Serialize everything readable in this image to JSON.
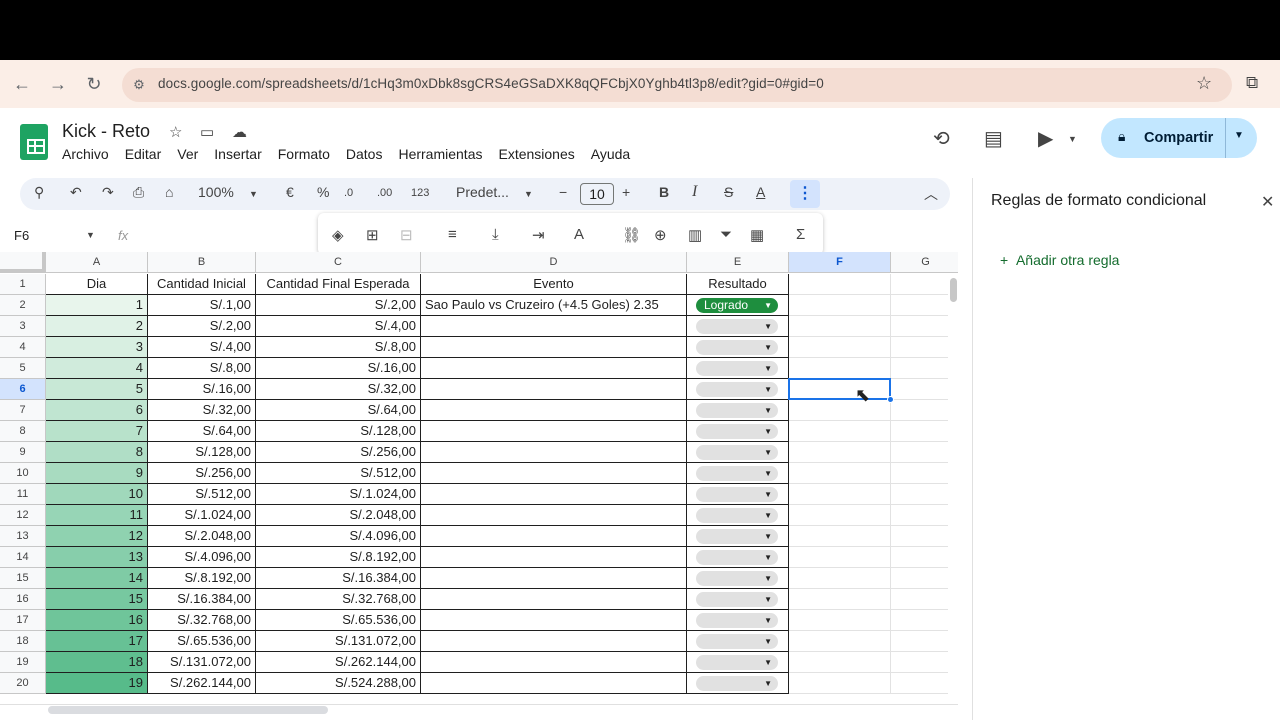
{
  "browser": {
    "url": "docs.google.com/spreadsheets/d/1cHq3m0xDbk8sgCRS4eGSaDXK8qQFCbjX0Yghb4tl3p8/edit?gid=0#gid=0"
  },
  "doc": {
    "title": "Kick - Reto",
    "menu": [
      "Archivo",
      "Editar",
      "Ver",
      "Insertar",
      "Formato",
      "Datos",
      "Herramientas",
      "Extensiones",
      "Ayuda"
    ],
    "share_label": "Compartir"
  },
  "toolbar": {
    "zoom": "100%",
    "currency": "€",
    "percent": "%",
    "dec_less": ".0",
    "dec_more": ".00",
    "number_format": "123",
    "font": "Predet...",
    "font_size": "10",
    "bold": "B",
    "italic": "I",
    "strike": "S",
    "text_color": "A"
  },
  "formula_bar": {
    "cell_ref": "F6",
    "fx": "fx"
  },
  "panel": {
    "title": "Reglas de formato condicional",
    "add_rule": "Añadir otra regla"
  },
  "colors": {
    "accent": "#1a73e8",
    "chip_logrado": "#1e8e3e",
    "share_bg": "#c2e7ff"
  },
  "sheet": {
    "columns": [
      "A",
      "B",
      "C",
      "D",
      "E",
      "F",
      "G"
    ],
    "selected_column": "F",
    "selected_row": "6",
    "headers": [
      "Dia",
      "Cantidad Inicial",
      "Cantidad Final Esperada",
      "Evento",
      "Resultado"
    ],
    "rows": [
      {
        "n": "2",
        "dia": "1",
        "ini": "S/.1,00",
        "fin": "S/.2,00",
        "evento": "Sao Paulo vs Cruzeiro (+4.5 Goles) 2.35",
        "res": "Logrado"
      },
      {
        "n": "3",
        "dia": "2",
        "ini": "S/.2,00",
        "fin": "S/.4,00",
        "evento": "",
        "res": ""
      },
      {
        "n": "4",
        "dia": "3",
        "ini": "S/.4,00",
        "fin": "S/.8,00",
        "evento": "",
        "res": ""
      },
      {
        "n": "5",
        "dia": "4",
        "ini": "S/.8,00",
        "fin": "S/.16,00",
        "evento": "",
        "res": ""
      },
      {
        "n": "6",
        "dia": "5",
        "ini": "S/.16,00",
        "fin": "S/.32,00",
        "evento": "",
        "res": ""
      },
      {
        "n": "7",
        "dia": "6",
        "ini": "S/.32,00",
        "fin": "S/.64,00",
        "evento": "",
        "res": ""
      },
      {
        "n": "8",
        "dia": "7",
        "ini": "S/.64,00",
        "fin": "S/.128,00",
        "evento": "",
        "res": ""
      },
      {
        "n": "9",
        "dia": "8",
        "ini": "S/.128,00",
        "fin": "S/.256,00",
        "evento": "",
        "res": ""
      },
      {
        "n": "10",
        "dia": "9",
        "ini": "S/.256,00",
        "fin": "S/.512,00",
        "evento": "",
        "res": ""
      },
      {
        "n": "11",
        "dia": "10",
        "ini": "S/.512,00",
        "fin": "S/.1.024,00",
        "evento": "",
        "res": ""
      },
      {
        "n": "12",
        "dia": "11",
        "ini": "S/.1.024,00",
        "fin": "S/.2.048,00",
        "evento": "",
        "res": ""
      },
      {
        "n": "13",
        "dia": "12",
        "ini": "S/.2.048,00",
        "fin": "S/.4.096,00",
        "evento": "",
        "res": ""
      },
      {
        "n": "14",
        "dia": "13",
        "ini": "S/.4.096,00",
        "fin": "S/.8.192,00",
        "evento": "",
        "res": ""
      },
      {
        "n": "15",
        "dia": "14",
        "ini": "S/.8.192,00",
        "fin": "S/.16.384,00",
        "evento": "",
        "res": ""
      },
      {
        "n": "16",
        "dia": "15",
        "ini": "S/.16.384,00",
        "fin": "S/.32.768,00",
        "evento": "",
        "res": ""
      },
      {
        "n": "17",
        "dia": "16",
        "ini": "S/.32.768,00",
        "fin": "S/.65.536,00",
        "evento": "",
        "res": ""
      },
      {
        "n": "18",
        "dia": "17",
        "ini": "S/.65.536,00",
        "fin": "S/.131.072,00",
        "evento": "",
        "res": ""
      },
      {
        "n": "19",
        "dia": "18",
        "ini": "S/.131.072,00",
        "fin": "S/.262.144,00",
        "evento": "",
        "res": ""
      },
      {
        "n": "20",
        "dia": "19",
        "ini": "S/.262.144,00",
        "fin": "S/.524.288,00",
        "evento": "",
        "res": ""
      }
    ]
  }
}
